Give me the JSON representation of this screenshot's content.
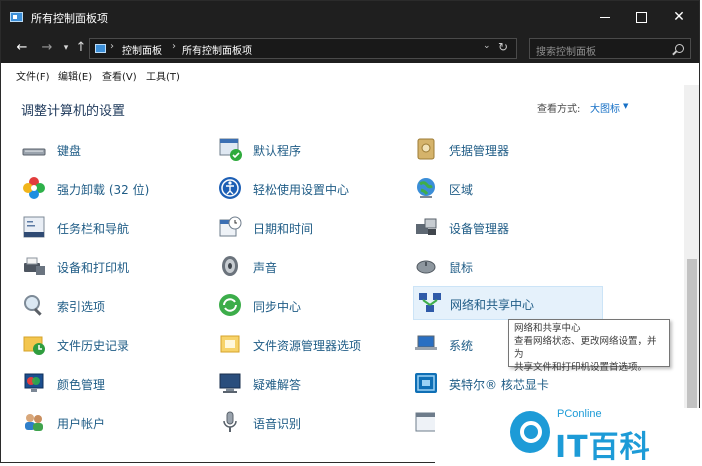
{
  "window": {
    "title": "所有控制面板项"
  },
  "addressbar": {
    "crumbs": [
      "控制面板",
      "所有控制面板项"
    ],
    "search_placeholder": "搜索控制面板"
  },
  "menu": [
    "文件(F)",
    "编辑(E)",
    "查看(V)",
    "工具(T)"
  ],
  "content": {
    "title": "调整计算机的设置",
    "view_by_label": "查看方式:",
    "view_by_value": "大图标"
  },
  "items": {
    "col1": [
      "键盘",
      "强力卸载 (32 位)",
      "任务栏和导航",
      "设备和打印机",
      "索引选项",
      "文件历史记录",
      "颜色管理",
      "用户帐户"
    ],
    "col2": [
      "默认程序",
      "轻松使用设置中心",
      "日期和时间",
      "声音",
      "同步中心",
      "文件资源管理器选项",
      "疑难解答",
      "语音识别"
    ],
    "col3": [
      "凭据管理器",
      "区域",
      "设备管理器",
      "鼠标",
      "网络和共享中心",
      "系统",
      "英特尔® 核芯显卡"
    ]
  },
  "tooltip": {
    "title": "网络和共享中心",
    "line1": "查看网络状态、更改网络设置，并为",
    "line2": "共享文件和打印机设置首选项。"
  },
  "watermark": {
    "top": "PConline",
    "main": "IT百科"
  },
  "colors": {
    "link": "#1f5c86",
    "accent": "#1670c6",
    "titlebar": "#1f1f1f"
  }
}
